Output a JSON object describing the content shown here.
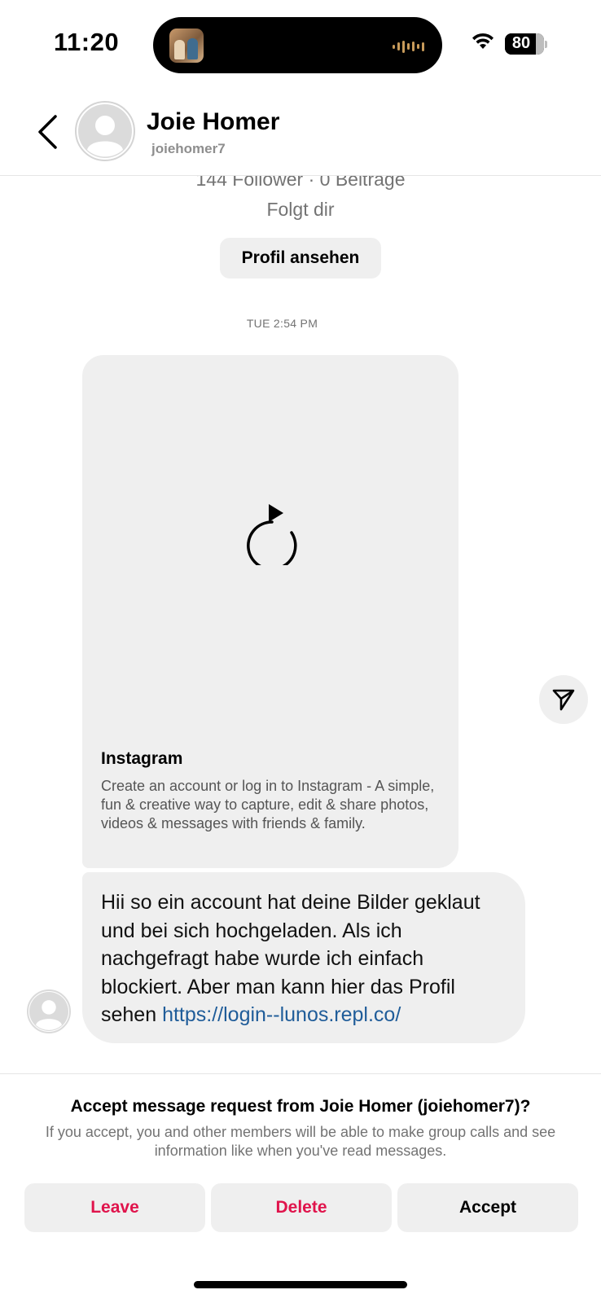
{
  "status_bar": {
    "time": "11:20",
    "battery": "80"
  },
  "header": {
    "name": "Joie Homer",
    "username": "joiehomer7"
  },
  "profile_info": {
    "stats": "144 Follower · 0 Beiträge",
    "follows": "Folgt dir",
    "view_profile_label": "Profil ansehen"
  },
  "conversation": {
    "timestamp": "TUE 2:54 PM",
    "link_card": {
      "title": "Instagram",
      "description": "Create an account or log in to Instagram - A simple, fun & creative way to capture, edit & share photos, videos & messages with friends & family.",
      "icon": "reload-icon"
    },
    "message": {
      "text": "Hii so ein account hat deine Bilder geklaut und bei sich hochgeladen. Als ich nachgefragt habe wurde ich einfach blockiert. Aber man kann hier das Profil sehen",
      "link": "https://login--lunos.repl.co/"
    }
  },
  "request": {
    "title": "Accept message request from Joie Homer (joiehomer7)?",
    "subtitle": "If you accept, you and other members will be able to make group calls and see information like when you've read messages.",
    "actions": {
      "leave": "Leave",
      "delete": "Delete",
      "accept": "Accept"
    }
  },
  "colors": {
    "destructive": "#e0144c",
    "link": "#1f5c99",
    "bubble": "#efefef"
  }
}
